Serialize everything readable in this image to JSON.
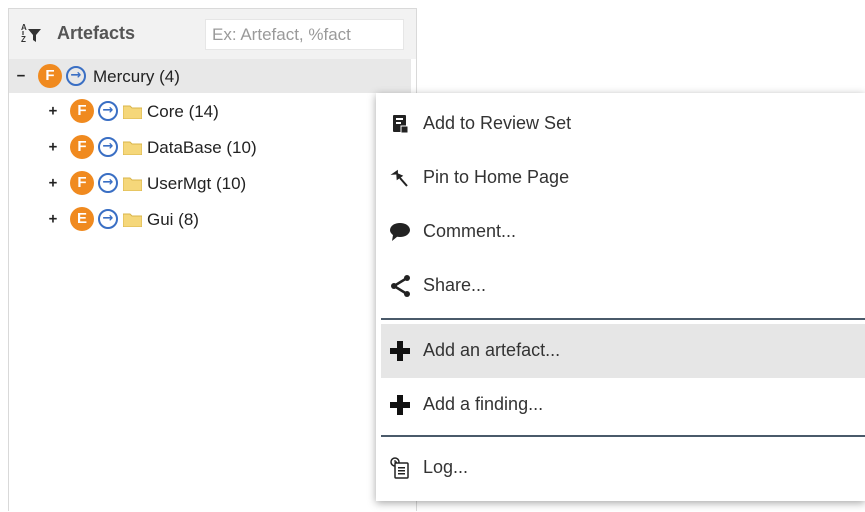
{
  "panel": {
    "title": "Artefacts",
    "search": {
      "value": "",
      "placeholder": "Ex: Artefact, %fact"
    }
  },
  "tree": {
    "root": {
      "expander": "−",
      "badge": "F",
      "label": "Mercury (4)"
    },
    "children": [
      {
        "expander": "+",
        "badge": "F",
        "label": "Core (14)"
      },
      {
        "expander": "+",
        "badge": "F",
        "label": "DataBase (10)"
      },
      {
        "expander": "+",
        "badge": "F",
        "label": "UserMgt (10)"
      },
      {
        "expander": "+",
        "badge": "E",
        "label": "Gui (8)"
      }
    ]
  },
  "menu": {
    "items": [
      {
        "label": "Add to Review Set",
        "icon": "review-set-icon"
      },
      {
        "label": "Pin to Home Page",
        "icon": "pin-icon"
      },
      {
        "label": "Comment...",
        "icon": "comment-icon"
      },
      {
        "label": "Share...",
        "icon": "share-icon"
      },
      {
        "label": "Add an artefact...",
        "icon": "plus-icon"
      },
      {
        "label": "Add a finding...",
        "icon": "plus-icon"
      },
      {
        "label": "Log...",
        "icon": "log-icon"
      }
    ]
  },
  "colors": {
    "badge": "#f08a1f",
    "goto": "#3a6fc4",
    "folder": "#f5d77a"
  }
}
